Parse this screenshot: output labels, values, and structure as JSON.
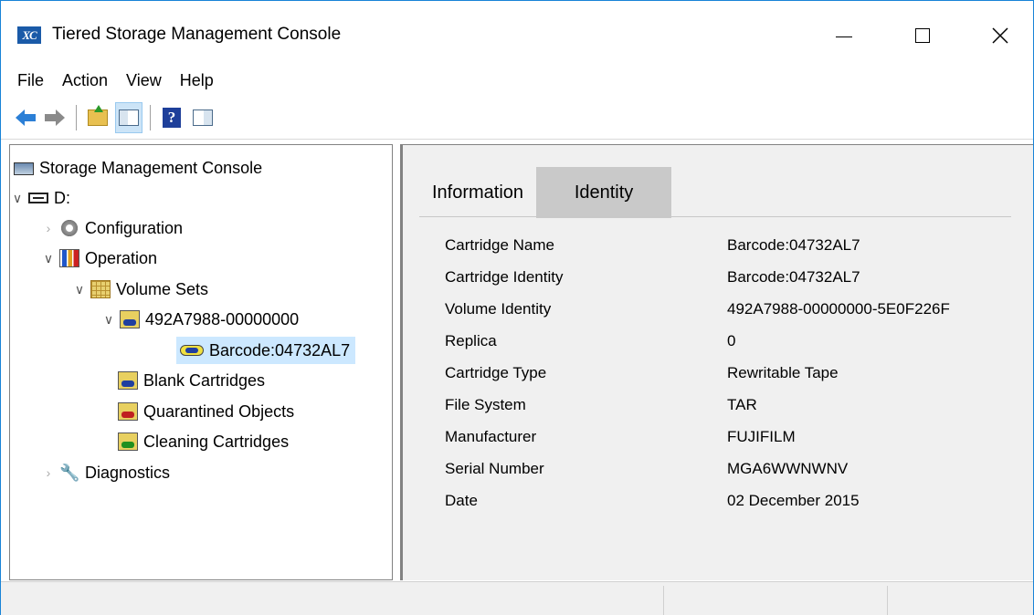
{
  "window": {
    "title": "Tiered Storage Management Console",
    "app_icon_text": "XC"
  },
  "menu": [
    "File",
    "Action",
    "View",
    "Help"
  ],
  "tree": {
    "root": "Storage Management Console",
    "drive": "D:",
    "configuration": "Configuration",
    "operation": "Operation",
    "volume_sets": "Volume Sets",
    "volume_set_item": "492A7988-00000000",
    "selected_cartridge": "Barcode:04732AL7",
    "blank_cartridges": "Blank Cartridges",
    "quarantined_objects": "Quarantined Objects",
    "cleaning_cartridges": "Cleaning Cartridges",
    "diagnostics": "Diagnostics"
  },
  "tabs": {
    "information": "Information",
    "identity": "Identity"
  },
  "properties": [
    {
      "label": "Cartridge Name",
      "value": "Barcode:04732AL7"
    },
    {
      "label": "Cartridge Identity",
      "value": "Barcode:04732AL7"
    },
    {
      "label": "Volume Identity",
      "value": "492A7988-00000000-5E0F226F"
    },
    {
      "label": "Replica",
      "value": "0"
    },
    {
      "label": "Cartridge Type",
      "value": "Rewritable Tape"
    },
    {
      "label": "File System",
      "value": "TAR"
    },
    {
      "label": "Manufacturer",
      "value": "FUJIFILM"
    },
    {
      "label": "Serial Number",
      "value": "MGA6WWNWNV"
    },
    {
      "label": "Date",
      "value": "02 December 2015"
    }
  ],
  "colors": {
    "window_border": "#1883d7",
    "selection": "#cce8ff",
    "active_tab": "#c9c9c9"
  }
}
